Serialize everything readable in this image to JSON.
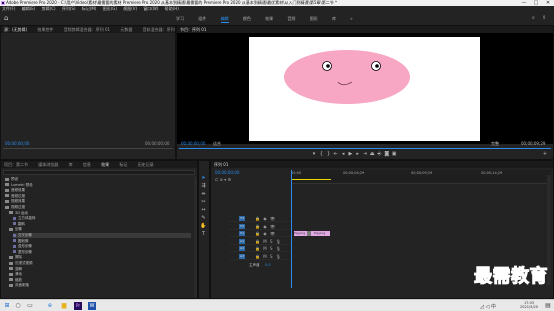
{
  "window": {
    "title": "Adobe Premiere Pro 2020 - C:\\用户\\Video\\素材\\最需要的素材 Premiere Pro 2020 从基本到精通\\最需要的 Premiere Pro 2020 从基本到精通\\最优素材\\从入门到精通\\第5章\\第二节 *",
    "minimize": "—",
    "maximize": "□",
    "close": "✕"
  },
  "menu": [
    "文件(F)",
    "编辑(E)",
    "剪辑(C)",
    "序列(S)",
    "标记(M)",
    "图形(G)",
    "视图(V)",
    "窗口(W)",
    "帮助(H)"
  ],
  "workspaces": {
    "tabs": [
      "学习",
      "组件",
      "编辑",
      "颜色",
      "效果",
      "音频",
      "图形",
      "库"
    ],
    "active_index": 2,
    "more": "»"
  },
  "source_panel": {
    "tabs": [
      "源：(无剪辑)",
      "效果控件",
      "音频剪辑混合器：序列 01",
      "元数据",
      "音轨混合器：序列 01"
    ],
    "timecode_left": "00;00;00;00",
    "timecode_right": "00;00;00;00"
  },
  "program_panel": {
    "tabs": [
      "节目：序列 01"
    ],
    "timecode": "00;00;00;00",
    "fit_label": "适合",
    "full_label": "完整",
    "duration": "00;00;09;29",
    "face": {
      "face_color": "#f7a6c3",
      "eye_color": "#000000"
    }
  },
  "project_panel": {
    "tabs": [
      "项目：第二节",
      "媒体浏览器",
      "库",
      "信息",
      "效果",
      "标记",
      "历史记录"
    ],
    "active_tab": "效果",
    "items": [
      {
        "label": "预设",
        "type": "folder"
      },
      {
        "label": "Lumetri 预设",
        "type": "folder"
      },
      {
        "label": "音频效果",
        "type": "folder"
      },
      {
        "label": "音频过渡",
        "type": "folder"
      },
      {
        "label": "视频效果",
        "type": "folder"
      },
      {
        "label": "视频过渡",
        "type": "folder"
      },
      {
        "label": "3D 运动",
        "type": "folder"
      },
      {
        "label": "立方体旋转",
        "type": "file"
      },
      {
        "label": "翻转",
        "type": "file"
      },
      {
        "label": "划像",
        "type": "folder"
      },
      {
        "label": "交叉划像",
        "type": "file",
        "selected": true
      },
      {
        "label": "圆划像",
        "type": "file"
      },
      {
        "label": "盒形划像",
        "type": "file"
      },
      {
        "label": "菱形划像",
        "type": "file"
      },
      {
        "label": "擦除",
        "type": "folder"
      },
      {
        "label": "沉浸式视频",
        "type": "folder"
      },
      {
        "label": "溶解",
        "type": "folder"
      },
      {
        "label": "滑动",
        "type": "folder"
      },
      {
        "label": "缩放",
        "type": "folder"
      },
      {
        "label": "页面剥落",
        "type": "folder"
      }
    ]
  },
  "timeline_panel": {
    "tabs": [
      "序列 01"
    ],
    "timecode": "00;00;00;00",
    "ruler": [
      "00;00",
      "00;00;04;29",
      "00;00;09;29",
      "00;00;14;29"
    ],
    "tracks": [
      {
        "id": "V3",
        "label": "V3"
      },
      {
        "id": "V2",
        "label": "V2"
      },
      {
        "id": "V1",
        "label": "V1"
      },
      {
        "id": "A1",
        "label": "A1"
      },
      {
        "id": "A2",
        "label": "A2"
      },
      {
        "id": "A3",
        "label": "A3"
      }
    ],
    "master_label": "主声道",
    "master_value": "0.0",
    "clips": [
      {
        "label": "Pig.png",
        "color": "#e2a8e6"
      },
      {
        "label": "Pig.png",
        "color": "#e2a8e6"
      }
    ]
  },
  "taskbar": {
    "time": "17:03",
    "date": "2021/5/20"
  },
  "watermark": "最需教育"
}
